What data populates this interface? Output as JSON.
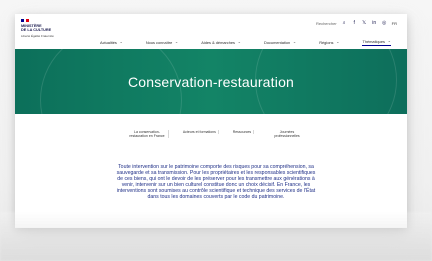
{
  "header": {
    "logo_lines": [
      "MINISTÈRE",
      "DE LA CULTURE"
    ],
    "logo_small": "Liberté\nÉgalité\nFraternité",
    "search_text": "Rechercher",
    "utility_icons": [
      "search-icon",
      "facebook-icon",
      "twitter-icon",
      "linkedin-icon",
      "instagram-icon"
    ],
    "language": "FR"
  },
  "nav": {
    "items": [
      "Actualités",
      "Nous connaître",
      "Aides & démarches",
      "Documentation",
      "Régions",
      "Thématiques"
    ]
  },
  "hero": {
    "title": "Conservation-restauration"
  },
  "tabs": [
    "La conservation-restauration en France",
    "Acteurs et formations",
    "Ressources",
    "Journées professionnelles"
  ],
  "intro": {
    "text": "Toute intervention sur le patrimoine comporte des risques pour sa compréhension, sa sauvegarde et sa transmission. Pour les propriétaires et les responsables scientifiques de ces biens, qui ont le devoir de les préserver pour les transmettre aux générations à venir, intervenir sur un bien culturel constitue donc un choix décisif. En France, les interventions sont soumises au contrôle scientifique et technique des services de l'État dans tous les domaines couverts par le code du patrimoine."
  },
  "colors": {
    "hero": "#0f7b61",
    "nav_accent": "#000091",
    "intro_text": "#1f2f87"
  }
}
